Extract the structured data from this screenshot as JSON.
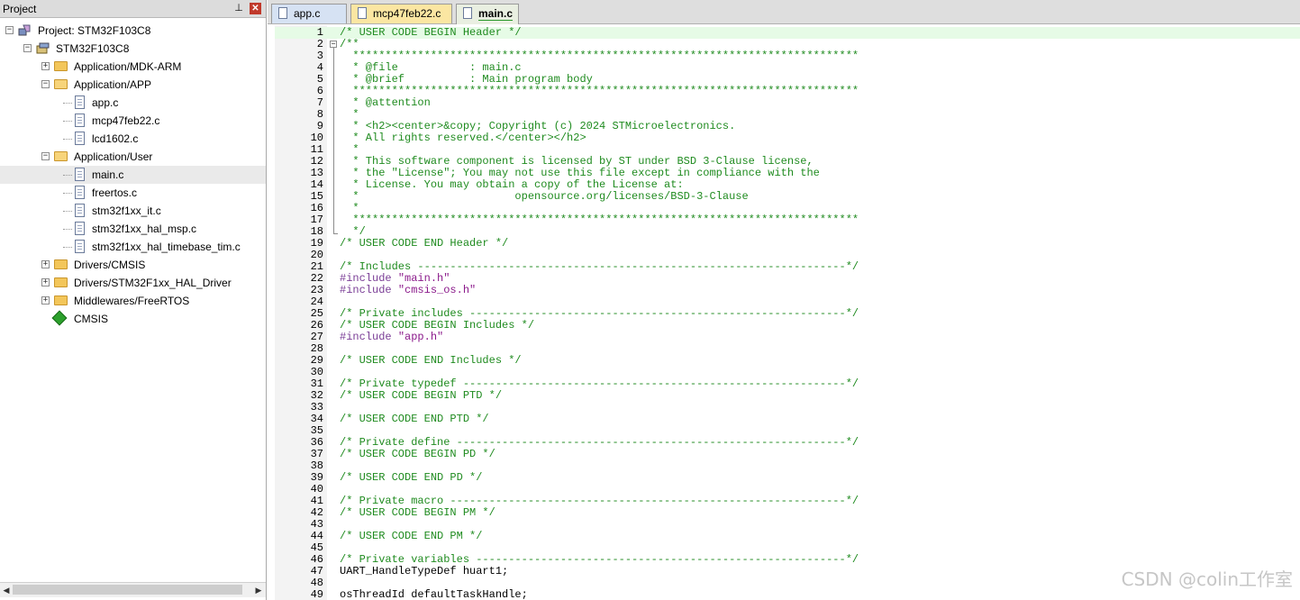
{
  "project_pane": {
    "title": "Project",
    "pin_glyph": "⊥",
    "close_glyph": "✕",
    "tree": [
      {
        "label": "Project: STM32F103C8",
        "icon": "project-icon",
        "expander": "−"
      },
      {
        "label": "STM32F103C8",
        "icon": "target-icon",
        "expander": "−"
      },
      {
        "label": "Application/MDK-ARM",
        "icon": "folder-icon",
        "expander": "+"
      },
      {
        "label": "Application/APP",
        "icon": "folder-open-icon",
        "expander": "−"
      },
      {
        "label": "app.c",
        "icon": "file-icon"
      },
      {
        "label": "mcp47feb22.c",
        "icon": "file-icon"
      },
      {
        "label": "lcd1602.c",
        "icon": "file-icon"
      },
      {
        "label": "Application/User",
        "icon": "folder-open-icon",
        "expander": "−"
      },
      {
        "label": "main.c",
        "icon": "file-icon",
        "selected": true
      },
      {
        "label": "freertos.c",
        "icon": "file-icon"
      },
      {
        "label": "stm32f1xx_it.c",
        "icon": "file-icon"
      },
      {
        "label": "stm32f1xx_hal_msp.c",
        "icon": "file-icon"
      },
      {
        "label": "stm32f1xx_hal_timebase_tim.c",
        "icon": "file-icon"
      },
      {
        "label": "Drivers/CMSIS",
        "icon": "folder-icon",
        "expander": "+"
      },
      {
        "label": "Drivers/STM32F1xx_HAL_Driver",
        "icon": "folder-icon",
        "expander": "+"
      },
      {
        "label": "Middlewares/FreeRTOS",
        "icon": "folder-icon",
        "expander": "+"
      },
      {
        "label": "CMSIS",
        "icon": "cmsis-icon"
      }
    ]
  },
  "tabs": [
    {
      "label": "app.c",
      "state": "normal"
    },
    {
      "label": "mcp47feb22.c",
      "state": "modified"
    },
    {
      "label": "main.c",
      "state": "active"
    }
  ],
  "colors": {
    "comment": "#1f8b1f",
    "preprocessor": "#7a3d96",
    "string": "#8b1a8b",
    "current_line": "#e6fbe6"
  },
  "code_lines": [
    {
      "n": "1",
      "text": "/* USER CODE BEGIN Header */",
      "kind": "comment"
    },
    {
      "n": "2",
      "text": "/**",
      "kind": "comment"
    },
    {
      "n": "3",
      "text": "  ******************************************************************************",
      "kind": "comment"
    },
    {
      "n": "4",
      "text": "  * @file           : main.c",
      "kind": "comment"
    },
    {
      "n": "5",
      "text": "  * @brief          : Main program body",
      "kind": "comment"
    },
    {
      "n": "6",
      "text": "  ******************************************************************************",
      "kind": "comment"
    },
    {
      "n": "7",
      "text": "  * @attention",
      "kind": "comment"
    },
    {
      "n": "8",
      "text": "  *",
      "kind": "comment"
    },
    {
      "n": "9",
      "text": "  * <h2><center>&copy; Copyright (c) 2024 STMicroelectronics.",
      "kind": "comment"
    },
    {
      "n": "10",
      "text": "  * All rights reserved.</center></h2>",
      "kind": "comment"
    },
    {
      "n": "11",
      "text": "  *",
      "kind": "comment"
    },
    {
      "n": "12",
      "text": "  * This software component is licensed by ST under BSD 3-Clause license,",
      "kind": "comment"
    },
    {
      "n": "13",
      "text": "  * the \"License\"; You may not use this file except in compliance with the",
      "kind": "comment"
    },
    {
      "n": "14",
      "text": "  * License. You may obtain a copy of the License at:",
      "kind": "comment"
    },
    {
      "n": "15",
      "text": "  *                        opensource.org/licenses/BSD-3-Clause",
      "kind": "comment"
    },
    {
      "n": "16",
      "text": "  *",
      "kind": "comment"
    },
    {
      "n": "17",
      "text": "  ******************************************************************************",
      "kind": "comment"
    },
    {
      "n": "18",
      "text": "  */",
      "kind": "comment"
    },
    {
      "n": "19",
      "text": "/* USER CODE END Header */",
      "kind": "comment"
    },
    {
      "n": "20",
      "text": "",
      "kind": "plain"
    },
    {
      "n": "21",
      "text": "/* Includes ------------------------------------------------------------------*/",
      "kind": "comment"
    },
    {
      "n": "22",
      "pre": "#include ",
      "str": "\"main.h\"",
      "kind": "include"
    },
    {
      "n": "23",
      "pre": "#include ",
      "str": "\"cmsis_os.h\"",
      "kind": "include"
    },
    {
      "n": "24",
      "text": "",
      "kind": "plain"
    },
    {
      "n": "25",
      "text": "/* Private includes ----------------------------------------------------------*/",
      "kind": "comment"
    },
    {
      "n": "26",
      "text": "/* USER CODE BEGIN Includes */",
      "kind": "comment"
    },
    {
      "n": "27",
      "pre": "#include ",
      "str": "\"app.h\"",
      "kind": "include"
    },
    {
      "n": "28",
      "text": "",
      "kind": "plain"
    },
    {
      "n": "29",
      "text": "/* USER CODE END Includes */",
      "kind": "comment"
    },
    {
      "n": "30",
      "text": "",
      "kind": "plain"
    },
    {
      "n": "31",
      "text": "/* Private typedef -----------------------------------------------------------*/",
      "kind": "comment"
    },
    {
      "n": "32",
      "text": "/* USER CODE BEGIN PTD */",
      "kind": "comment"
    },
    {
      "n": "33",
      "text": "",
      "kind": "plain"
    },
    {
      "n": "34",
      "text": "/* USER CODE END PTD */",
      "kind": "comment"
    },
    {
      "n": "35",
      "text": "",
      "kind": "plain"
    },
    {
      "n": "36",
      "text": "/* Private define ------------------------------------------------------------*/",
      "kind": "comment"
    },
    {
      "n": "37",
      "text": "/* USER CODE BEGIN PD */",
      "kind": "comment"
    },
    {
      "n": "38",
      "text": "",
      "kind": "plain"
    },
    {
      "n": "39",
      "text": "/* USER CODE END PD */",
      "kind": "comment"
    },
    {
      "n": "40",
      "text": "",
      "kind": "plain"
    },
    {
      "n": "41",
      "text": "/* Private macro -------------------------------------------------------------*/",
      "kind": "comment"
    },
    {
      "n": "42",
      "text": "/* USER CODE BEGIN PM */",
      "kind": "comment"
    },
    {
      "n": "43",
      "text": "",
      "kind": "plain"
    },
    {
      "n": "44",
      "text": "/* USER CODE END PM */",
      "kind": "comment"
    },
    {
      "n": "45",
      "text": "",
      "kind": "plain"
    },
    {
      "n": "46",
      "text": "/* Private variables ---------------------------------------------------------*/",
      "kind": "comment"
    },
    {
      "n": "47",
      "text": "UART_HandleTypeDef huart1;",
      "kind": "plain"
    },
    {
      "n": "48",
      "text": "",
      "kind": "plain"
    },
    {
      "n": "49",
      "text": "osThreadId defaultTaskHandle;",
      "kind": "plain"
    }
  ],
  "watermark": "CSDN @colin工作室"
}
